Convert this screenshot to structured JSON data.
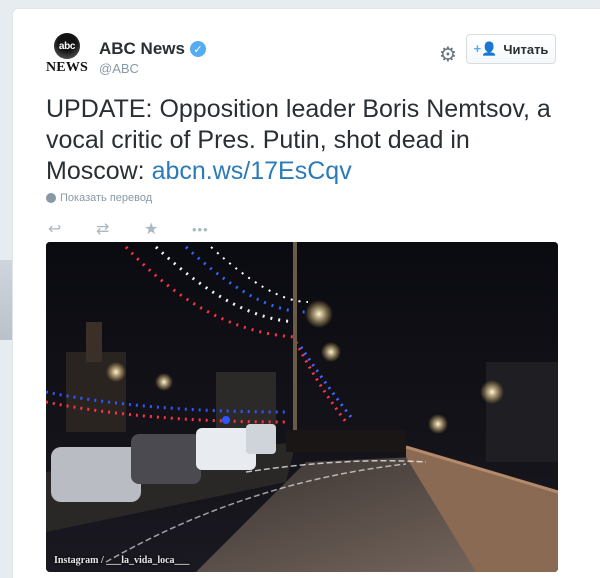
{
  "account": {
    "name": "ABC News",
    "handle": "@ABC",
    "avatar_text": "abc",
    "avatar_subtext": "NEWS",
    "verified_icon": "verified-check-icon"
  },
  "actions_header": {
    "follow_label": "Читать",
    "follow_icon": "add-user-icon",
    "settings_icon": "gear-icon"
  },
  "tweet": {
    "text": "UPDATE: Opposition leader Boris Nemtsov, a vocal critic of Pres. Putin, shot dead in Moscow:",
    "link": "abcn.ws/17EsCqv",
    "translate_label": "Показать перевод"
  },
  "tweet_actions": [
    {
      "name": "reply-icon",
      "glyph": "↩"
    },
    {
      "name": "retweet-icon",
      "glyph": "⇄"
    },
    {
      "name": "favorite-icon",
      "glyph": "★"
    },
    {
      "name": "more-icon",
      "glyph": "•••"
    }
  ],
  "photo": {
    "credit": "Instagram / ___la_vida_loca___"
  },
  "colors": {
    "link": "#2b7bb9",
    "accent": "#55acee",
    "text": "#292f33",
    "muted": "#8899a6"
  }
}
